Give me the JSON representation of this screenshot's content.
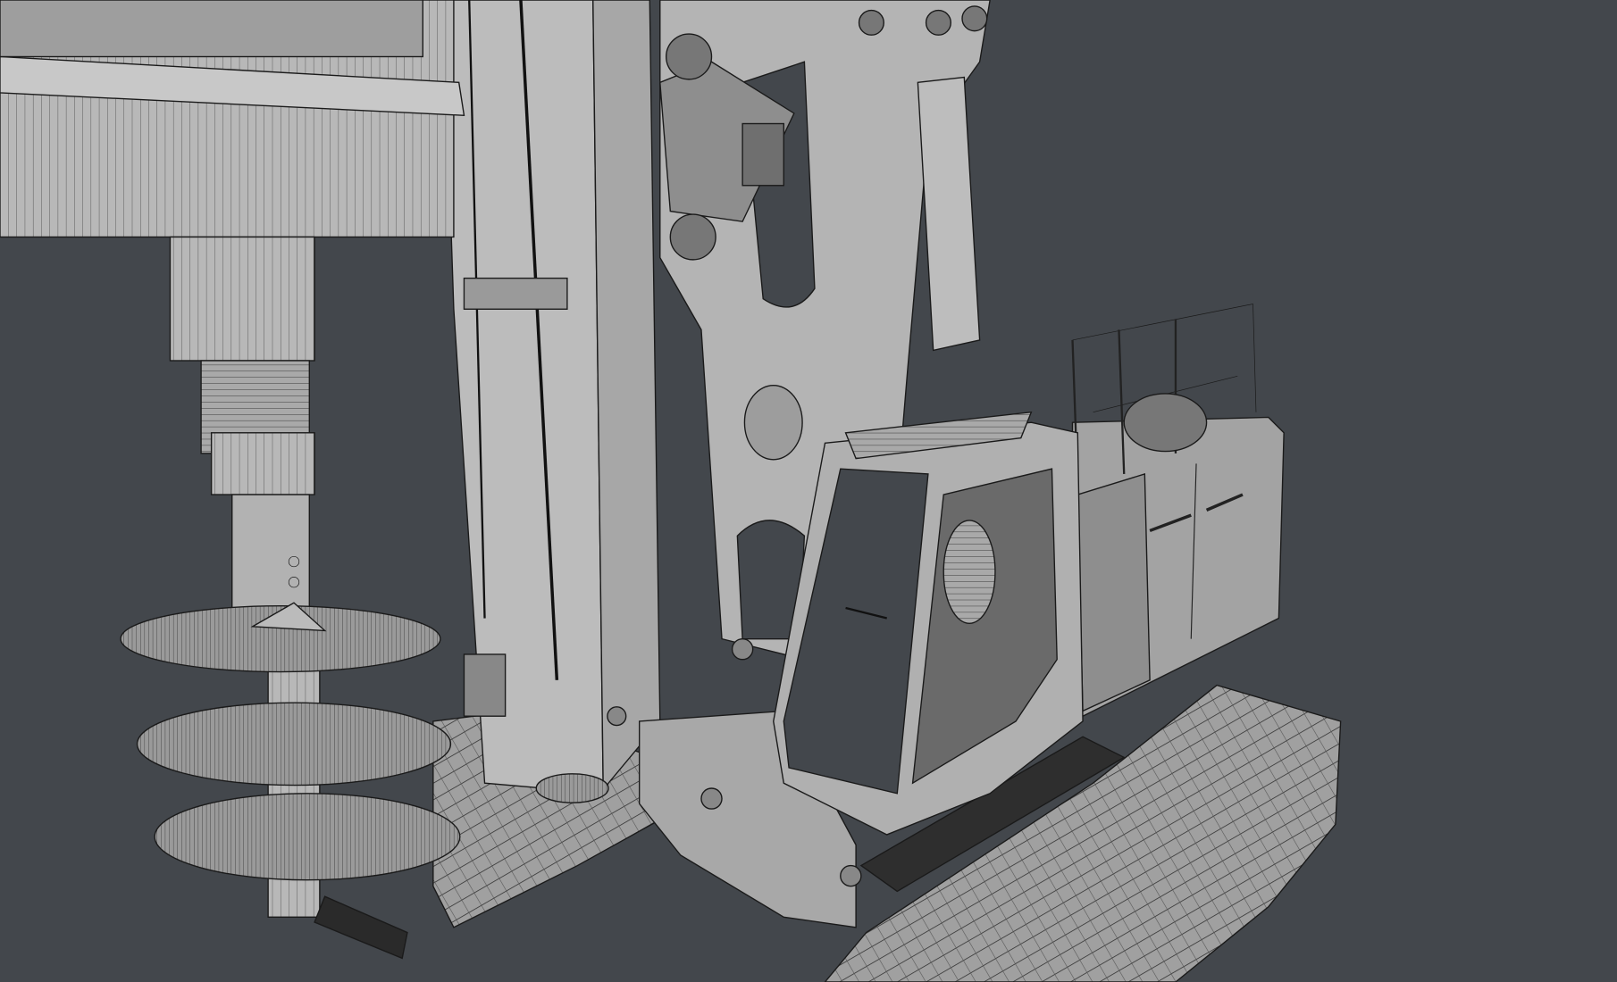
{
  "scene": {
    "subject": "drilling-rig-wireframe-render",
    "colors": {
      "background": "#43474c",
      "surface_light": "#b8b8b8",
      "surface_mid": "#9c9c9c",
      "surface_dark": "#7c7c7c",
      "edge": "#1a1a1a"
    }
  }
}
